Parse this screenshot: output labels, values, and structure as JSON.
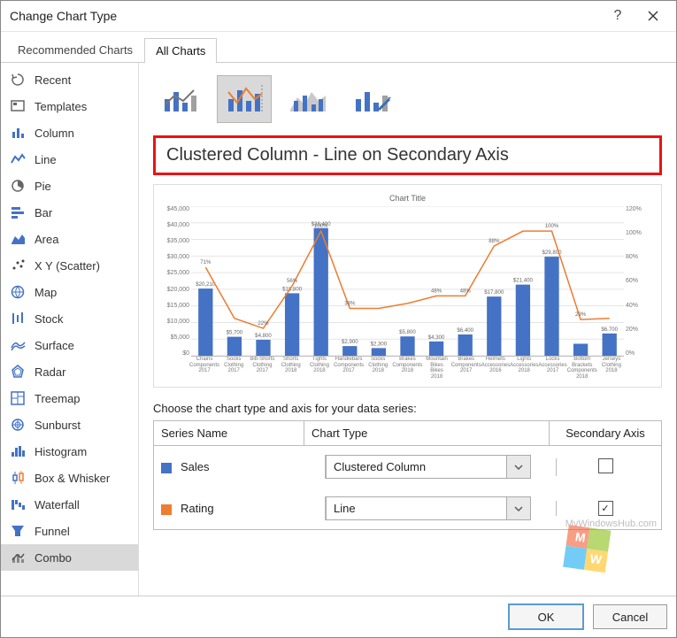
{
  "window": {
    "title": "Change Chart Type",
    "help_label": "?",
    "close_label": "Close"
  },
  "tabs": {
    "recommended": "Recommended Charts",
    "all": "All Charts"
  },
  "sidebar": [
    {
      "name": "recent",
      "label": "Recent"
    },
    {
      "name": "templates",
      "label": "Templates"
    },
    {
      "name": "column",
      "label": "Column"
    },
    {
      "name": "line",
      "label": "Line"
    },
    {
      "name": "pie",
      "label": "Pie"
    },
    {
      "name": "bar",
      "label": "Bar"
    },
    {
      "name": "area",
      "label": "Area"
    },
    {
      "name": "xy",
      "label": "X Y (Scatter)"
    },
    {
      "name": "map",
      "label": "Map"
    },
    {
      "name": "stock",
      "label": "Stock"
    },
    {
      "name": "surface",
      "label": "Surface"
    },
    {
      "name": "radar",
      "label": "Radar"
    },
    {
      "name": "treemap",
      "label": "Treemap"
    },
    {
      "name": "sunburst",
      "label": "Sunburst"
    },
    {
      "name": "histogram",
      "label": "Histogram"
    },
    {
      "name": "box",
      "label": "Box & Whisker"
    },
    {
      "name": "waterfall",
      "label": "Waterfall"
    },
    {
      "name": "funnel",
      "label": "Funnel"
    },
    {
      "name": "combo",
      "label": "Combo"
    }
  ],
  "heading": "Clustered Column - Line on Secondary Axis",
  "series_caption": "Choose the chart type and axis for your data series:",
  "series_header": {
    "name": "Series Name",
    "type": "Chart Type",
    "sec": "Secondary Axis"
  },
  "series": [
    {
      "name": "Sales",
      "color": "#4472c4",
      "type": "Clustered Column",
      "secondary": false
    },
    {
      "name": "Rating",
      "color": "#ed7d31",
      "type": "Line",
      "secondary": true
    }
  ],
  "footer": {
    "ok": "OK",
    "cancel": "Cancel"
  },
  "watermark": "MyWindowsHub.com",
  "chart_data": {
    "type": "combo",
    "title": "Chart Title",
    "y_left": {
      "label": "",
      "min": 0,
      "max": 45000,
      "ticks": [
        "$45,000",
        "$40,000",
        "$35,000",
        "$30,000",
        "$25,000",
        "$20,000",
        "$15,000",
        "$10,000",
        "$5,000",
        "$0"
      ]
    },
    "y_right": {
      "label": "",
      "min": 0,
      "max": 1.2,
      "ticks": [
        "120%",
        "100%",
        "80%",
        "60%",
        "40%",
        "20%",
        "0%"
      ]
    },
    "categories": [
      {
        "c": "Chains",
        "g": "Components",
        "y": "2017"
      },
      {
        "c": "Socks",
        "g": "Clothing",
        "y": "2017"
      },
      {
        "c": "Bib-Shorts",
        "g": "Clothing",
        "y": "2017"
      },
      {
        "c": "Shorts",
        "g": "Clothing",
        "y": "2018"
      },
      {
        "c": "Tights",
        "g": "Clothing",
        "y": "2018"
      },
      {
        "c": "Handlebars",
        "g": "Components",
        "y": "2017"
      },
      {
        "c": "Socks",
        "g": "Clothing",
        "y": "2018"
      },
      {
        "c": "Brakes",
        "g": "Components",
        "y": "2018"
      },
      {
        "c": "Mountain Bikes",
        "g": "Bikes",
        "y": "2018"
      },
      {
        "c": "Brakes",
        "g": "Components",
        "y": "2017"
      },
      {
        "c": "Helmets",
        "g": "Accessories",
        "y": "2016"
      },
      {
        "c": "Lights",
        "g": "Accessories",
        "y": "2018"
      },
      {
        "c": "Locks",
        "g": "Accessories",
        "y": "2017"
      },
      {
        "c": "Bottom Brackets",
        "g": "Components",
        "y": "2018"
      },
      {
        "c": "Jerseys",
        "g": "Clothing",
        "y": "2018"
      }
    ],
    "series": [
      {
        "name": "Sales",
        "type": "bar",
        "axis": "left",
        "values": [
          20210,
          5700,
          4800,
          18800,
          38400,
          2900,
          2300,
          5800,
          4300,
          6400,
          17800,
          21400,
          29800,
          3600,
          6700
        ],
        "labels": [
          "$20,210",
          "$5,700",
          "$4,800",
          "$18,800",
          "$38,400",
          "$2,900",
          "$2,300",
          "$5,800",
          "$4,300",
          "$6,400",
          "$17,800",
          "$21,400",
          "$29,800",
          "",
          "$6,700"
        ]
      },
      {
        "name": "Rating",
        "type": "line",
        "axis": "right",
        "values": [
          0.71,
          0.3,
          0.22,
          0.56,
          1.0,
          0.38,
          0.38,
          0.42,
          0.48,
          0.48,
          0.88,
          1.0,
          1.0,
          0.29,
          0.3
        ],
        "labels": [
          "71%",
          "",
          "22%",
          "56%",
          "100%",
          "38%",
          "",
          "",
          "48%",
          "48%",
          "88%",
          "",
          "100%",
          "29%",
          ""
        ]
      }
    ]
  }
}
